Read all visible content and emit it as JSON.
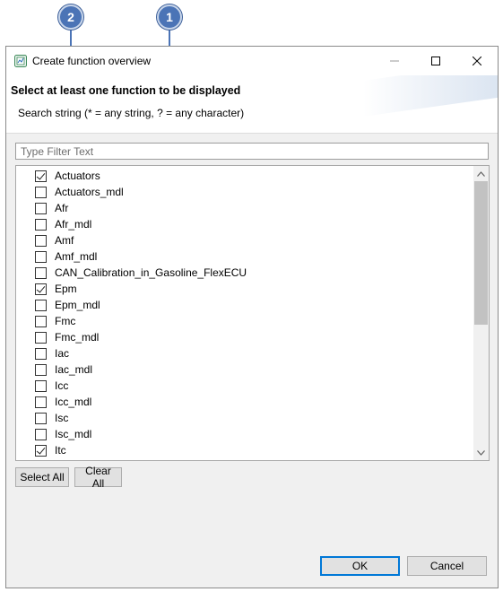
{
  "callouts": [
    {
      "number": "2"
    },
    {
      "number": "1"
    }
  ],
  "window": {
    "title": "Create function overview",
    "app_icon": "chart-window-icon"
  },
  "header": {
    "title": "Select at least one function to be displayed",
    "subtitle": "Search string (* = any string, ? = any character)"
  },
  "filter": {
    "value": "",
    "placeholder": "Type Filter Text"
  },
  "functions": [
    {
      "label": "Actuators",
      "checked": true
    },
    {
      "label": "Actuators_mdl",
      "checked": false
    },
    {
      "label": "Afr",
      "checked": false
    },
    {
      "label": "Afr_mdl",
      "checked": false
    },
    {
      "label": "Amf",
      "checked": false
    },
    {
      "label": "Amf_mdl",
      "checked": false
    },
    {
      "label": "CAN_Calibration_in_Gasoline_FlexECU",
      "checked": false
    },
    {
      "label": "Epm",
      "checked": true
    },
    {
      "label": "Epm_mdl",
      "checked": false
    },
    {
      "label": "Fmc",
      "checked": false
    },
    {
      "label": "Fmc_mdl",
      "checked": false
    },
    {
      "label": "Iac",
      "checked": false
    },
    {
      "label": "Iac_mdl",
      "checked": false
    },
    {
      "label": "Icc",
      "checked": false
    },
    {
      "label": "Icc_mdl",
      "checked": false
    },
    {
      "label": "Isc",
      "checked": false
    },
    {
      "label": "Isc_mdl",
      "checked": false
    },
    {
      "label": "Itc",
      "checked": true
    }
  ],
  "buttons": {
    "select_all": "Select All",
    "clear_all": "Clear All",
    "ok": "OK",
    "cancel": "Cancel"
  },
  "colors": {
    "callout": "#4b74b6",
    "default_button_border": "#0078d7"
  }
}
